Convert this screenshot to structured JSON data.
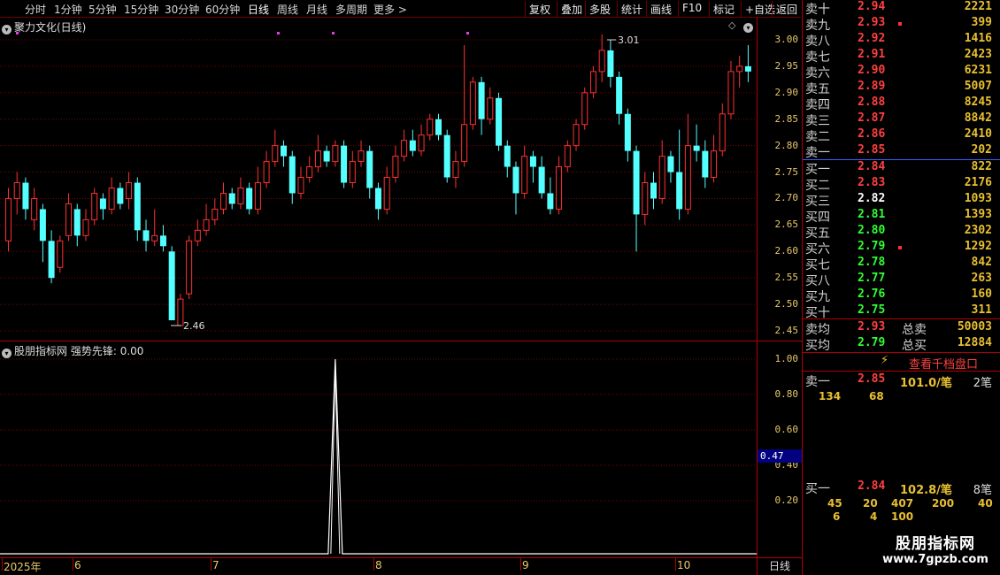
{
  "tabs": [
    "分时",
    "1分钟",
    "5分钟",
    "15分钟",
    "30分钟",
    "60分钟",
    "日线",
    "周线",
    "月线",
    "多周期",
    "更多 >"
  ],
  "active_tab": "日线",
  "tools": [
    "复权",
    "叠加",
    "多股",
    "统计",
    "画线",
    "F10",
    "标记",
    "+自选",
    "返回"
  ],
  "chart_title": "聚力文化(日线)",
  "indicator_title": "股朋指标网",
  "indicator_name": "强势先锋: 0.00",
  "high_label": "3.01",
  "low_label": "2.46",
  "price_ticks": [
    "3.00",
    "2.95",
    "2.90",
    "2.85",
    "2.80",
    "2.75",
    "2.70",
    "2.65",
    "2.60",
    "2.55",
    "2.50",
    "2.45"
  ],
  "ind_ticks": [
    "1.00",
    "0.80",
    "0.60",
    "0.40",
    "0.20"
  ],
  "ind_marker": "0.47",
  "x_labels": [
    "2025年",
    "6",
    "7",
    "8",
    "9",
    "10"
  ],
  "x_period": "日线",
  "colors": {
    "up": "#ff3030",
    "down": "#54ffff",
    "grid": "#7a0000"
  },
  "asks": [
    {
      "label": "卖十",
      "price": "2.94",
      "vol": "2221"
    },
    {
      "label": "卖九",
      "price": "2.93",
      "vol": "399",
      "mark": true
    },
    {
      "label": "卖八",
      "price": "2.92",
      "vol": "1416"
    },
    {
      "label": "卖七",
      "price": "2.91",
      "vol": "2423"
    },
    {
      "label": "卖六",
      "price": "2.90",
      "vol": "6231"
    },
    {
      "label": "卖五",
      "price": "2.89",
      "vol": "5007"
    },
    {
      "label": "卖四",
      "price": "2.88",
      "vol": "8245"
    },
    {
      "label": "卖三",
      "price": "2.87",
      "vol": "8842"
    },
    {
      "label": "卖二",
      "price": "2.86",
      "vol": "2410"
    },
    {
      "label": "卖一",
      "price": "2.85",
      "vol": "202"
    }
  ],
  "bids": [
    {
      "label": "买一",
      "price": "2.84",
      "vol": "822",
      "c": "red"
    },
    {
      "label": "买二",
      "price": "2.83",
      "vol": "2176",
      "c": "red"
    },
    {
      "label": "买三",
      "price": "2.82",
      "vol": "1093",
      "c": "white"
    },
    {
      "label": "买四",
      "price": "2.81",
      "vol": "1393",
      "c": "green"
    },
    {
      "label": "买五",
      "price": "2.80",
      "vol": "2302",
      "c": "green"
    },
    {
      "label": "买六",
      "price": "2.79",
      "vol": "1292",
      "c": "green",
      "mark": true
    },
    {
      "label": "买七",
      "price": "2.78",
      "vol": "842",
      "c": "green"
    },
    {
      "label": "买八",
      "price": "2.77",
      "vol": "263",
      "c": "green"
    },
    {
      "label": "买九",
      "price": "2.76",
      "vol": "160",
      "c": "green"
    },
    {
      "label": "买十",
      "price": "2.75",
      "vol": "311",
      "c": "green"
    }
  ],
  "avg_sell": {
    "label": "卖均",
    "price": "2.93",
    "total_label": "总卖",
    "total": "50003"
  },
  "avg_buy": {
    "label": "买均",
    "price": "2.79",
    "total_label": "总买",
    "total": "12884"
  },
  "qiandang": "查看千档盘口",
  "sell1": {
    "label": "卖一",
    "price": "2.85",
    "avg": "101.0/笔",
    "count": "2笔",
    "orders": [
      "134",
      "68"
    ]
  },
  "buy1": {
    "label": "买一",
    "price": "2.84",
    "avg": "102.8/笔",
    "count": "8笔",
    "orders_row1": [
      "45",
      "20",
      "407",
      "200",
      "40"
    ],
    "orders_row2": [
      "6",
      "4",
      "100"
    ]
  },
  "watermark": "股朋指标网",
  "watermark_url": "www.7gpzb.com",
  "chart_data": {
    "type": "candlestick",
    "y_range": [
      2.45,
      3.02
    ],
    "candles": [
      [
        2.62,
        2.7,
        2.72,
        2.6
      ],
      [
        2.7,
        2.73,
        2.75,
        2.67
      ],
      [
        2.73,
        2.68,
        2.74,
        2.66
      ],
      [
        2.66,
        2.7,
        2.72,
        2.64
      ],
      [
        2.68,
        2.62,
        2.69,
        2.58
      ],
      [
        2.62,
        2.55,
        2.64,
        2.54
      ],
      [
        2.57,
        2.62,
        2.63,
        2.56
      ],
      [
        2.63,
        2.69,
        2.71,
        2.62
      ],
      [
        2.68,
        2.63,
        2.69,
        2.61
      ],
      [
        2.63,
        2.66,
        2.68,
        2.62
      ],
      [
        2.66,
        2.71,
        2.72,
        2.65
      ],
      [
        2.7,
        2.68,
        2.71,
        2.66
      ],
      [
        2.68,
        2.72,
        2.74,
        2.67
      ],
      [
        2.72,
        2.69,
        2.73,
        2.68
      ],
      [
        2.7,
        2.73,
        2.75,
        2.68
      ],
      [
        2.73,
        2.64,
        2.74,
        2.62
      ],
      [
        2.64,
        2.62,
        2.66,
        2.6
      ],
      [
        2.62,
        2.63,
        2.68,
        2.61
      ],
      [
        2.63,
        2.61,
        2.65,
        2.6
      ],
      [
        2.6,
        2.47,
        2.61,
        2.47
      ],
      [
        2.46,
        2.51,
        2.52,
        2.46
      ],
      [
        2.52,
        2.62,
        2.63,
        2.51
      ],
      [
        2.62,
        2.64,
        2.66,
        2.61
      ],
      [
        2.64,
        2.66,
        2.69,
        2.63
      ],
      [
        2.66,
        2.68,
        2.7,
        2.65
      ],
      [
        2.68,
        2.71,
        2.73,
        2.67
      ],
      [
        2.71,
        2.69,
        2.72,
        2.68
      ],
      [
        2.69,
        2.72,
        2.74,
        2.68
      ],
      [
        2.72,
        2.68,
        2.73,
        2.67
      ],
      [
        2.68,
        2.73,
        2.76,
        2.67
      ],
      [
        2.73,
        2.77,
        2.79,
        2.72
      ],
      [
        2.77,
        2.8,
        2.83,
        2.76
      ],
      [
        2.8,
        2.78,
        2.81,
        2.76
      ],
      [
        2.78,
        2.71,
        2.79,
        2.69
      ],
      [
        2.71,
        2.74,
        2.76,
        2.7
      ],
      [
        2.74,
        2.76,
        2.78,
        2.73
      ],
      [
        2.76,
        2.79,
        2.82,
        2.75
      ],
      [
        2.79,
        2.77,
        2.8,
        2.76
      ],
      [
        2.77,
        2.8,
        2.81,
        2.76
      ],
      [
        2.8,
        2.73,
        2.81,
        2.72
      ],
      [
        2.73,
        2.77,
        2.79,
        2.72
      ],
      [
        2.77,
        2.79,
        2.81,
        2.76
      ],
      [
        2.79,
        2.72,
        2.8,
        2.7
      ],
      [
        2.72,
        2.68,
        2.73,
        2.66
      ],
      [
        2.68,
        2.74,
        2.76,
        2.67
      ],
      [
        2.74,
        2.78,
        2.8,
        2.73
      ],
      [
        2.78,
        2.81,
        2.83,
        2.77
      ],
      [
        2.81,
        2.79,
        2.83,
        2.78
      ],
      [
        2.79,
        2.82,
        2.84,
        2.78
      ],
      [
        2.82,
        2.85,
        2.86,
        2.81
      ],
      [
        2.85,
        2.82,
        2.86,
        2.81
      ],
      [
        2.82,
        2.74,
        2.83,
        2.73
      ],
      [
        2.74,
        2.77,
        2.79,
        2.72
      ],
      [
        2.77,
        2.84,
        2.99,
        2.76
      ],
      [
        2.84,
        2.92,
        2.93,
        2.83
      ],
      [
        2.92,
        2.85,
        2.93,
        2.82
      ],
      [
        2.85,
        2.89,
        2.91,
        2.84
      ],
      [
        2.89,
        2.8,
        2.9,
        2.79
      ],
      [
        2.8,
        2.76,
        2.81,
        2.74
      ],
      [
        2.76,
        2.71,
        2.77,
        2.67
      ],
      [
        2.71,
        2.78,
        2.8,
        2.7
      ],
      [
        2.78,
        2.76,
        2.79,
        2.73
      ],
      [
        2.76,
        2.71,
        2.78,
        2.7
      ],
      [
        2.71,
        2.68,
        2.74,
        2.67
      ],
      [
        2.68,
        2.76,
        2.78,
        2.67
      ],
      [
        2.76,
        2.8,
        2.81,
        2.75
      ],
      [
        2.8,
        2.84,
        2.85,
        2.79
      ],
      [
        2.84,
        2.9,
        2.91,
        2.83
      ],
      [
        2.9,
        2.94,
        2.95,
        2.89
      ],
      [
        2.94,
        2.98,
        3.01,
        2.92
      ],
      [
        2.98,
        2.93,
        3.0,
        2.91
      ],
      [
        2.93,
        2.86,
        2.94,
        2.84
      ],
      [
        2.86,
        2.79,
        2.87,
        2.77
      ],
      [
        2.79,
        2.67,
        2.8,
        2.6
      ],
      [
        2.67,
        2.73,
        2.75,
        2.65
      ],
      [
        2.73,
        2.7,
        2.75,
        2.68
      ],
      [
        2.7,
        2.78,
        2.81,
        2.69
      ],
      [
        2.78,
        2.75,
        2.79,
        2.73
      ],
      [
        2.75,
        2.68,
        2.83,
        2.66
      ],
      [
        2.68,
        2.8,
        2.86,
        2.67
      ],
      [
        2.8,
        2.79,
        2.84,
        2.77
      ],
      [
        2.79,
        2.74,
        2.81,
        2.72
      ],
      [
        2.74,
        2.79,
        2.82,
        2.73
      ],
      [
        2.79,
        2.86,
        2.88,
        2.78
      ],
      [
        2.86,
        2.94,
        2.96,
        2.85
      ],
      [
        2.94,
        2.95,
        2.97,
        2.91
      ],
      [
        2.95,
        2.94,
        2.99,
        2.92
      ]
    ]
  },
  "indicator_data": {
    "type": "line",
    "y_range": [
      0,
      1.05
    ],
    "spike_index": 38,
    "spike_value": 1.0
  }
}
